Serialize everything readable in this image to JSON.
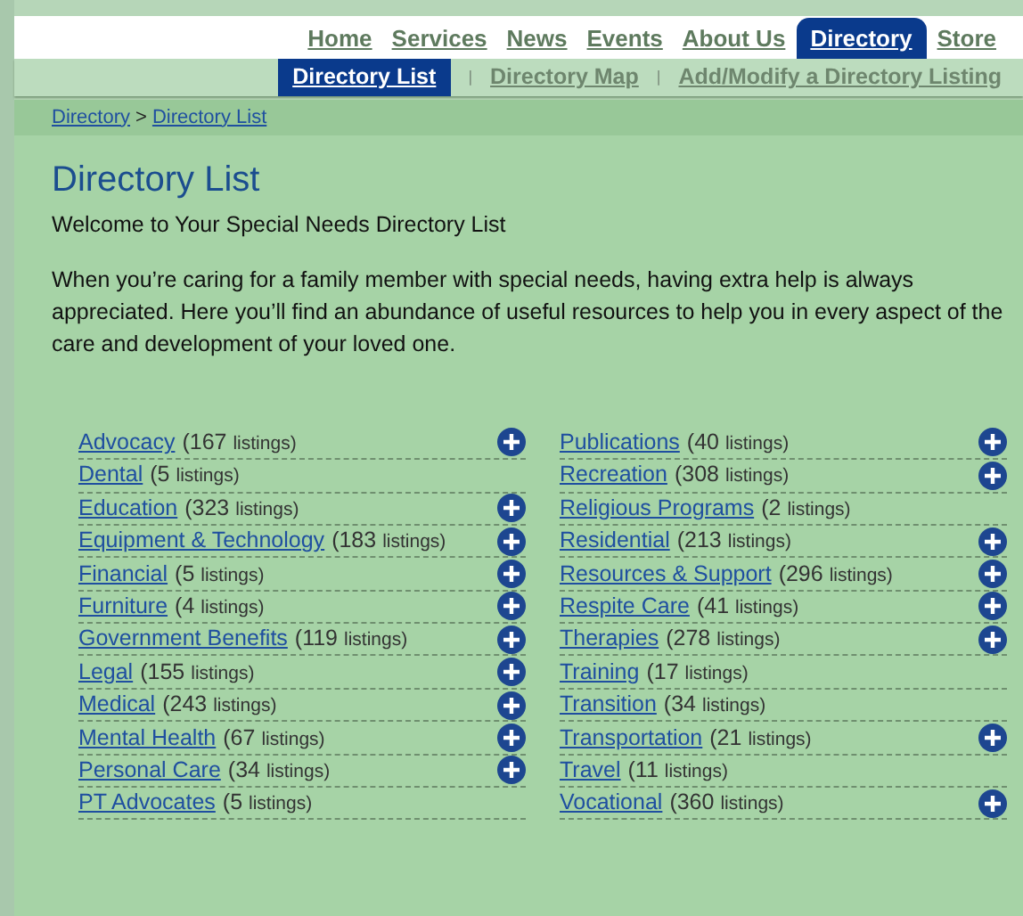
{
  "main_nav": [
    {
      "label": "Home",
      "selected": false
    },
    {
      "label": "Services",
      "selected": false
    },
    {
      "label": "News",
      "selected": false
    },
    {
      "label": "Events",
      "selected": false
    },
    {
      "label": "About Us",
      "selected": false
    },
    {
      "label": "Directory",
      "selected": true
    },
    {
      "label": "Store",
      "selected": false
    }
  ],
  "sub_nav": [
    {
      "label": "Directory List",
      "selected": true
    },
    {
      "label": "Directory Map",
      "selected": false
    },
    {
      "label": "Add/Modify a Directory Listing",
      "selected": false
    }
  ],
  "sub_nav_separator": "|",
  "breadcrumb": {
    "items": [
      "Directory",
      "Directory List"
    ],
    "separator": ">"
  },
  "title": "Directory List",
  "intro": "Welcome to Your Special Needs Directory List",
  "description": "When you’re caring for a family member with special needs, having extra help is always appreciated. Here you’ll find an abundance of useful resources to help you in every aspect of the care and development of your loved one.",
  "columns": [
    [
      {
        "name": "Advocacy",
        "count": "(167",
        "unit": "listings)",
        "expandable": true
      },
      {
        "name": "Dental",
        "count": "(5",
        "unit": "listings)",
        "expandable": false
      },
      {
        "name": "Education",
        "count": "(323",
        "unit": "listings)",
        "expandable": true
      },
      {
        "name": "Equipment & Technology",
        "count": "(183",
        "unit": "listings)",
        "expandable": true
      },
      {
        "name": "Financial",
        "count": "(5",
        "unit": "listings)",
        "expandable": true
      },
      {
        "name": "Furniture",
        "count": "(4",
        "unit": "listings)",
        "expandable": true
      },
      {
        "name": "Government Benefits",
        "count": "(119",
        "unit": "listings)",
        "expandable": true
      },
      {
        "name": "Legal",
        "count": "(155",
        "unit": "listings)",
        "expandable": true
      },
      {
        "name": "Medical",
        "count": "(243",
        "unit": "listings)",
        "expandable": true
      },
      {
        "name": "Mental Health",
        "count": "(67",
        "unit": "listings)",
        "expandable": true
      },
      {
        "name": "Personal Care",
        "count": "(34",
        "unit": "listings)",
        "expandable": true
      },
      {
        "name": "PT Advocates",
        "count": "(5",
        "unit": "listings)",
        "expandable": false
      }
    ],
    [
      {
        "name": "Publications",
        "count": "(40",
        "unit": "listings)",
        "expandable": true
      },
      {
        "name": "Recreation",
        "count": "(308",
        "unit": "listings)",
        "expandable": true
      },
      {
        "name": "Religious Programs",
        "count": "(2",
        "unit": "listings)",
        "expandable": false
      },
      {
        "name": "Residential",
        "count": "(213",
        "unit": "listings)",
        "expandable": true
      },
      {
        "name": "Resources & Support",
        "count": "(296",
        "unit": "listings)",
        "expandable": true
      },
      {
        "name": "Respite Care",
        "count": "(41",
        "unit": "listings)",
        "expandable": true
      },
      {
        "name": "Therapies",
        "count": "(278",
        "unit": "listings)",
        "expandable": true
      },
      {
        "name": "Training",
        "count": "(17",
        "unit": "listings)",
        "expandable": false
      },
      {
        "name": "Transition",
        "count": "(34",
        "unit": "listings)",
        "expandable": false
      },
      {
        "name": "Transportation",
        "count": "(21",
        "unit": "listings)",
        "expandable": true
      },
      {
        "name": "Travel",
        "count": "(11",
        "unit": "listings)",
        "expandable": false
      },
      {
        "name": "Vocational",
        "count": "(360",
        "unit": "listings)",
        "expandable": true
      }
    ]
  ]
}
